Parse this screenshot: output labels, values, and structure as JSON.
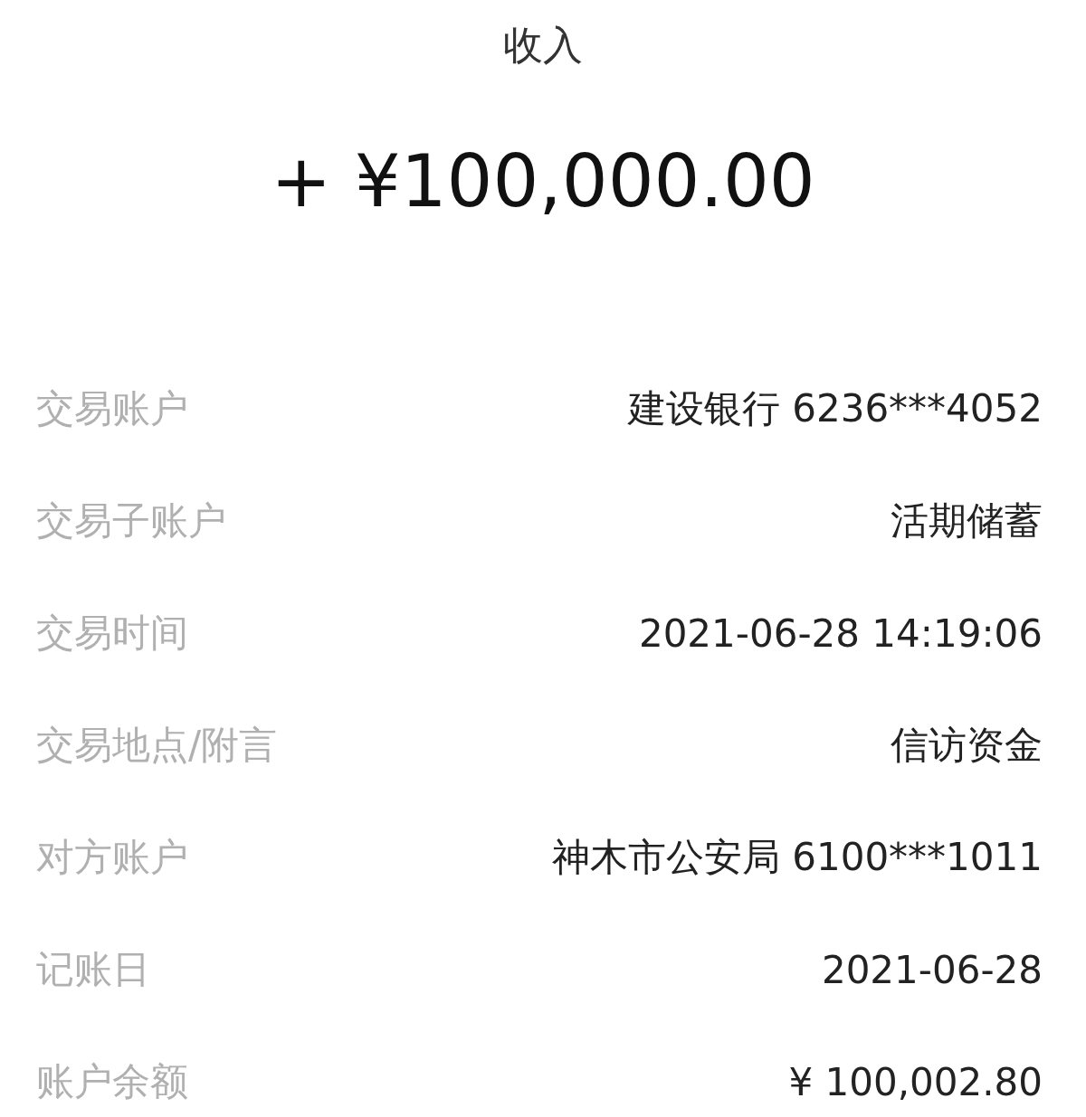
{
  "header": {
    "title": "收入",
    "amount": "+ ¥100,000.00"
  },
  "details": [
    {
      "label": "交易账户",
      "value": "建设银行 6236***4052"
    },
    {
      "label": "交易子账户",
      "value": "活期储蓄"
    },
    {
      "label": "交易时间",
      "value": "2021-06-28 14:19:06"
    },
    {
      "label": "交易地点/附言",
      "value": "信访资金"
    },
    {
      "label": "对方账户",
      "value": "神木市公安局 6100***1011"
    },
    {
      "label": "记账日",
      "value": "2021-06-28"
    },
    {
      "label": "账户余额",
      "value": "¥ 100,002.80"
    }
  ]
}
